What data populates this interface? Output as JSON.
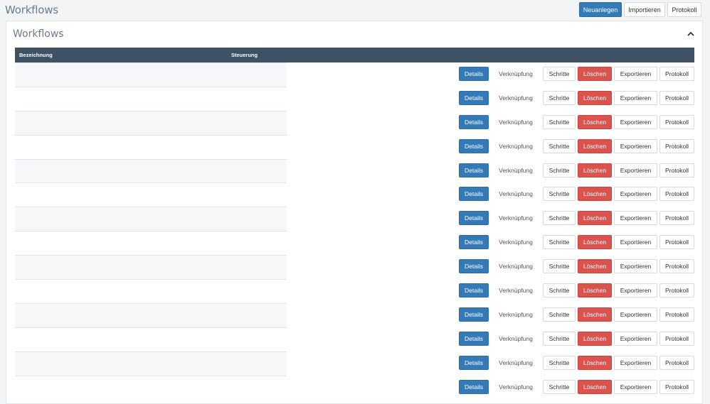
{
  "header": {
    "title": "Workflows",
    "actions": {
      "new": "Neuanlegen",
      "import": "Importieren",
      "log": "Protokoll"
    }
  },
  "panel": {
    "title": "Workflows",
    "collapse_icon": "chevron-up-icon"
  },
  "table": {
    "columns": {
      "name": "Bezeichnung",
      "control": "Steuerung"
    },
    "row_actions": {
      "details": "Details",
      "link": "Verknüpfung",
      "steps": "Schritte",
      "delete": "Löschen",
      "export": "Exportieren",
      "log": "Protokoll"
    },
    "row_count": 14
  },
  "colors": {
    "primary": "#337ab7",
    "danger": "#d9534f",
    "table_header": "#3e5264",
    "title_text": "#6b7b8c"
  }
}
